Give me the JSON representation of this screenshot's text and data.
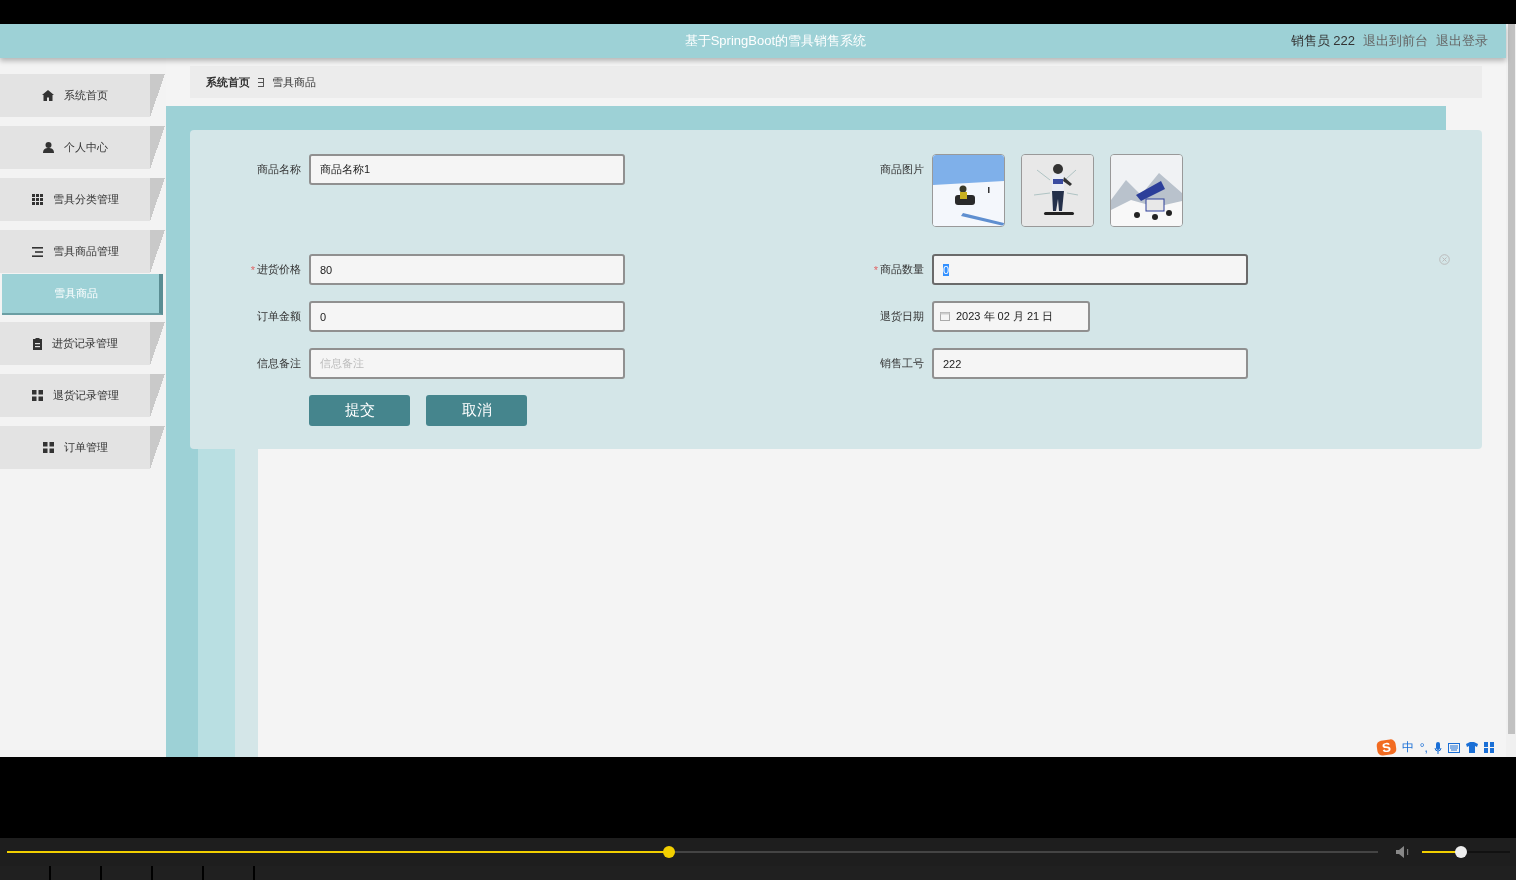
{
  "header": {
    "title": "基于SpringBoot的雪具销售系统",
    "user": "销售员 222",
    "links": [
      "退出到前台",
      "退出登录"
    ]
  },
  "sidebar": {
    "items": [
      {
        "label": "系统首页",
        "selected": false
      },
      {
        "label": "个人中心",
        "selected": false
      },
      {
        "label": "雪具分类管理",
        "selected": false
      },
      {
        "label": "雪具商品管理",
        "selected": false,
        "children": [
          {
            "label": "雪具商品",
            "selected": true
          }
        ]
      },
      {
        "label": "进货记录管理",
        "selected": false
      },
      {
        "label": "退货记录管理",
        "selected": false
      },
      {
        "label": "订单管理",
        "selected": false
      }
    ]
  },
  "breadcrumb": [
    "系统首页",
    "雪具商品"
  ],
  "form": {
    "rows": [
      [
        {
          "kind": "text",
          "label": "商品名称",
          "value": "商品名称1",
          "focused": false
        },
        {
          "kind": "images",
          "label": "商品图片"
        }
      ],
      [
        {
          "kind": "text",
          "label": "进货价格",
          "value": "80",
          "required_mark": "*",
          "focused": false
        },
        {
          "kind": "text",
          "label": "商品数量",
          "value": "0",
          "required_mark": "*",
          "focused": true
        }
      ],
      [
        {
          "kind": "text",
          "label": "订单金额",
          "value": "0",
          "focused": false
        },
        {
          "kind": "date",
          "label": "退货日期",
          "value": "2023 年 02 月 21 日"
        }
      ],
      [
        {
          "kind": "text",
          "label": "信息备注",
          "placeholder": "信息备注",
          "focused": false
        },
        {
          "kind": "text",
          "label": "销售工号",
          "value": "222",
          "focused": false
        }
      ]
    ],
    "buttons": [
      "提交",
      "取消"
    ]
  },
  "player": {
    "progress": {
      "level": 0.483
    },
    "volume": {
      "level": 0.44
    }
  },
  "ime": {
    "logo": "S",
    "mode": "中",
    "punct": "°,"
  }
}
